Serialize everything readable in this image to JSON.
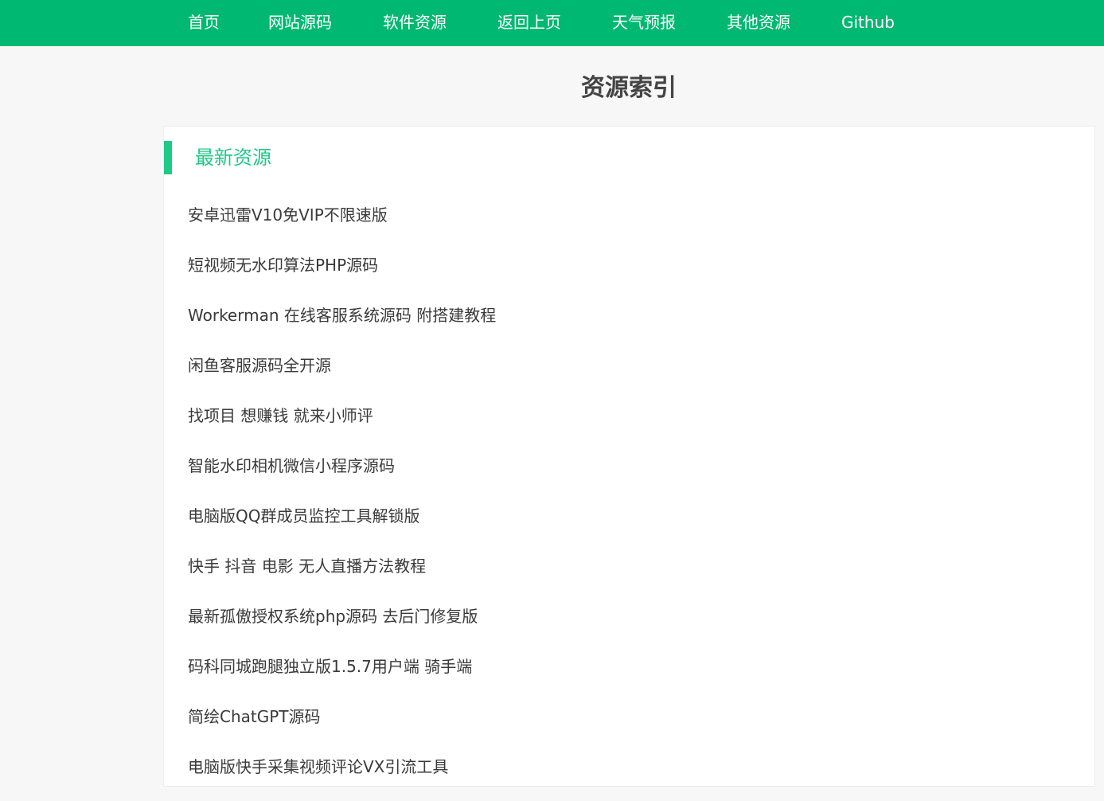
{
  "colors": {
    "brand_green": "#00b871",
    "section_accent": "#1fc986",
    "nav_text": "#ffffff"
  },
  "nav": {
    "items": [
      {
        "label": "首页"
      },
      {
        "label": "网站源码"
      },
      {
        "label": "软件资源"
      },
      {
        "label": "返回上页"
      },
      {
        "label": "天气预报"
      },
      {
        "label": "其他资源"
      },
      {
        "label": "Github"
      }
    ]
  },
  "page": {
    "title": "资源索引"
  },
  "section": {
    "title": "最新资源",
    "items": [
      {
        "label": "安卓迅雷V10免VIP不限速版"
      },
      {
        "label": "短视频无水印算法PHP源码"
      },
      {
        "label": "Workerman 在线客服系统源码 附搭建教程"
      },
      {
        "label": "闲鱼客服源码全开源"
      },
      {
        "label": "找项目 想赚钱 就来小师评"
      },
      {
        "label": "智能水印相机微信小程序源码"
      },
      {
        "label": "电脑版QQ群成员监控工具解锁版"
      },
      {
        "label": "快手 抖音 电影 无人直播方法教程"
      },
      {
        "label": "最新孤傲授权系统php源码 去后门修复版"
      },
      {
        "label": "码科同城跑腿独立版1.5.7用户端 骑手端"
      },
      {
        "label": "简绘ChatGPT源码"
      },
      {
        "label": "电脑版快手采集视频评论VX引流工具"
      }
    ]
  }
}
